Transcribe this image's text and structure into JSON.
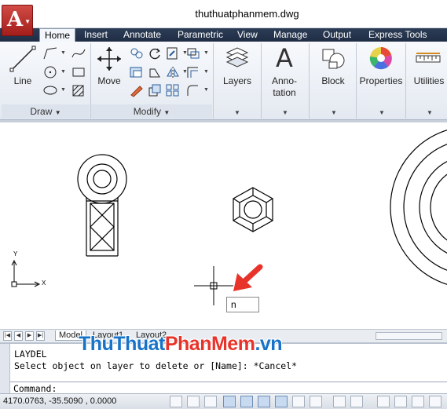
{
  "window": {
    "title": "thuthuatphanmem.dwg"
  },
  "app_menu": {
    "logo": "A"
  },
  "tabs": [
    {
      "label": "Home"
    },
    {
      "label": "Insert"
    },
    {
      "label": "Annotate"
    },
    {
      "label": "Parametric"
    },
    {
      "label": "View"
    },
    {
      "label": "Manage"
    },
    {
      "label": "Output"
    },
    {
      "label": "Express Tools"
    }
  ],
  "ribbon": {
    "draw": {
      "line_label": "Line",
      "panel_label": "Draw"
    },
    "modify": {
      "move_label": "Move",
      "panel_label": "Modify"
    },
    "layers_label": "Layers",
    "annotation": {
      "line1": "Anno-",
      "line2": "tation",
      "glyph": "A"
    },
    "block_label": "Block",
    "properties_label": "Properties",
    "utilities_label": "Utilities"
  },
  "canvas": {
    "ucs": {
      "x_label": "X",
      "y_label": "Y"
    },
    "dynamic_input_value": "n"
  },
  "layout_tabs": [
    {
      "label": "Model"
    },
    {
      "label": "Layout1"
    },
    {
      "label": "Layout2"
    }
  ],
  "command": {
    "history": [
      "LAYDEL",
      "Select object on layer to delete or [Name]: *Cancel*"
    ],
    "prompt": "Command:"
  },
  "watermark": {
    "part1": "ThuThuat",
    "part2": "PhanMem",
    "part3": ".vn"
  },
  "status_bar": {
    "coordinates": "4170.0763, -35.5090 , 0.0000"
  },
  "colors": {
    "tab_bar": "#2c3d56",
    "accent_red": "#e8332a",
    "watermark_blue": "#1673c8"
  }
}
